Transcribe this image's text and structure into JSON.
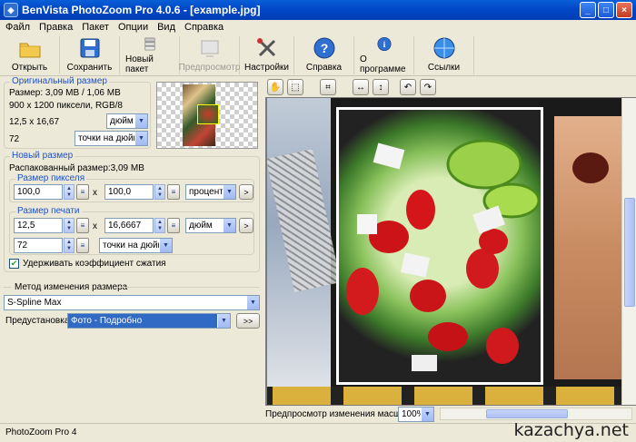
{
  "window": {
    "title": "BenVista PhotoZoom Pro 4.0.6 - [example.jpg]",
    "minimize": "_",
    "maximize": "□",
    "close": "×"
  },
  "menu": [
    "Файл",
    "Правка",
    "Пакет",
    "Опции",
    "Вид",
    "Справка"
  ],
  "toolbar": {
    "open": "Открыть",
    "save": "Сохранить",
    "batch": "Новый пакет",
    "preview": "Предпросмотр",
    "settings": "Настройки",
    "help": "Справка",
    "about": "О программе",
    "links": "Ссылки"
  },
  "original": {
    "group_label": "Оригинальный размер",
    "size": "Размер: 3,09 MB / 1,06 MB",
    "dimensions": "900 x 1200 пиксели, RGB/8",
    "print_size": "12,5 x 16,67",
    "unit": "дюйм",
    "resolution": "72",
    "res_unit": "точки на дюйм"
  },
  "new_size": {
    "group_label": "Новый размер",
    "unpacked": "Распакованный размер:3,09 MB",
    "pixel_group_label": "Размер пикселя",
    "pixel_width": "100,0",
    "pixel_height": "100,0",
    "pixel_unit": "процент",
    "print_group_label": "Размер печати",
    "print_width": "12,5",
    "print_height": "16,6667",
    "print_unit": "дюйм",
    "print_res": "72",
    "print_res_unit": "точки на дюйм",
    "x": "x",
    "keep_ratio": "Удерживать коэффициент сжатия",
    "keep_ratio_checked": true
  },
  "method": {
    "group_label": "Метод изменения размера",
    "algorithm": "S-Spline Max",
    "preset_label": "Предустановка:",
    "preset": "Фото - Подробно",
    "preset_more": ">>"
  },
  "zoom": {
    "label": "Предпросмотр изменения масштаба:",
    "value": "100%"
  },
  "status": "PhotoZoom Pro 4",
  "watermark": "kazachya.net",
  "colors": {
    "title_blue": "#0149c8",
    "group_label": "#1d50c9",
    "selection": "#316ac5"
  }
}
